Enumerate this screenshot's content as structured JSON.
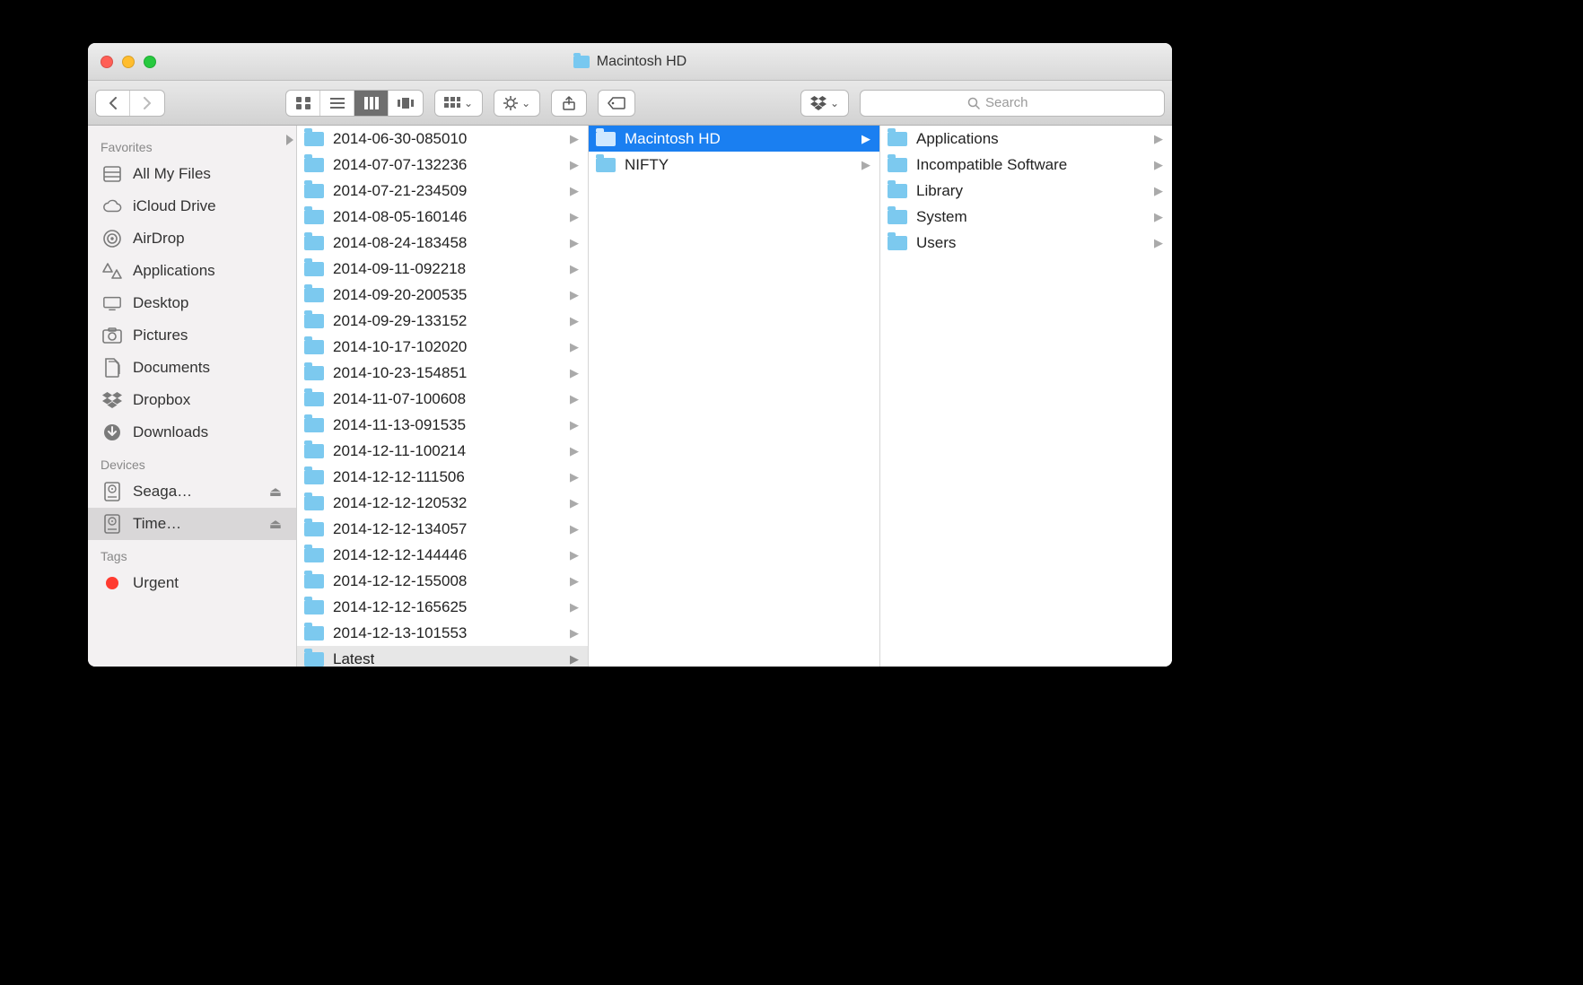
{
  "window": {
    "title": "Macintosh HD"
  },
  "toolbar": {
    "search_placeholder": "Search"
  },
  "sidebar": {
    "sections": [
      {
        "header": "Favorites",
        "items": [
          {
            "label": "All My Files",
            "icon": "all-my-files"
          },
          {
            "label": "iCloud Drive",
            "icon": "cloud"
          },
          {
            "label": "AirDrop",
            "icon": "airdrop"
          },
          {
            "label": "Applications",
            "icon": "applications"
          },
          {
            "label": "Desktop",
            "icon": "desktop"
          },
          {
            "label": "Pictures",
            "icon": "pictures"
          },
          {
            "label": "Documents",
            "icon": "documents"
          },
          {
            "label": "Dropbox",
            "icon": "dropbox"
          },
          {
            "label": "Downloads",
            "icon": "downloads"
          }
        ]
      },
      {
        "header": "Devices",
        "items": [
          {
            "label": "Seaga…",
            "icon": "disk",
            "ejectable": true
          },
          {
            "label": "Time…",
            "icon": "disk",
            "ejectable": true,
            "selected": true
          }
        ]
      },
      {
        "header": "Tags",
        "items": [
          {
            "label": "Urgent",
            "icon": "tag-red"
          }
        ]
      }
    ]
  },
  "columns": [
    {
      "items": [
        {
          "label": "2014-06-30-085010"
        },
        {
          "label": "2014-07-07-132236"
        },
        {
          "label": "2014-07-21-234509"
        },
        {
          "label": "2014-08-05-160146"
        },
        {
          "label": "2014-08-24-183458"
        },
        {
          "label": "2014-09-11-092218"
        },
        {
          "label": "2014-09-20-200535"
        },
        {
          "label": "2014-09-29-133152"
        },
        {
          "label": "2014-10-17-102020"
        },
        {
          "label": "2014-10-23-154851"
        },
        {
          "label": "2014-11-07-100608"
        },
        {
          "label": "2014-11-13-091535"
        },
        {
          "label": "2014-12-11-100214"
        },
        {
          "label": "2014-12-12-111506"
        },
        {
          "label": "2014-12-12-120532"
        },
        {
          "label": "2014-12-12-134057"
        },
        {
          "label": "2014-12-12-144446"
        },
        {
          "label": "2014-12-12-155008"
        },
        {
          "label": "2014-12-12-165625"
        },
        {
          "label": "2014-12-13-101553"
        },
        {
          "label": "Latest",
          "state": "openpath"
        }
      ]
    },
    {
      "items": [
        {
          "label": "Macintosh HD",
          "state": "selected"
        },
        {
          "label": "NIFTY"
        }
      ]
    },
    {
      "items": [
        {
          "label": "Applications"
        },
        {
          "label": "Incompatible Software"
        },
        {
          "label": "Library"
        },
        {
          "label": "System"
        },
        {
          "label": "Users"
        }
      ]
    }
  ]
}
